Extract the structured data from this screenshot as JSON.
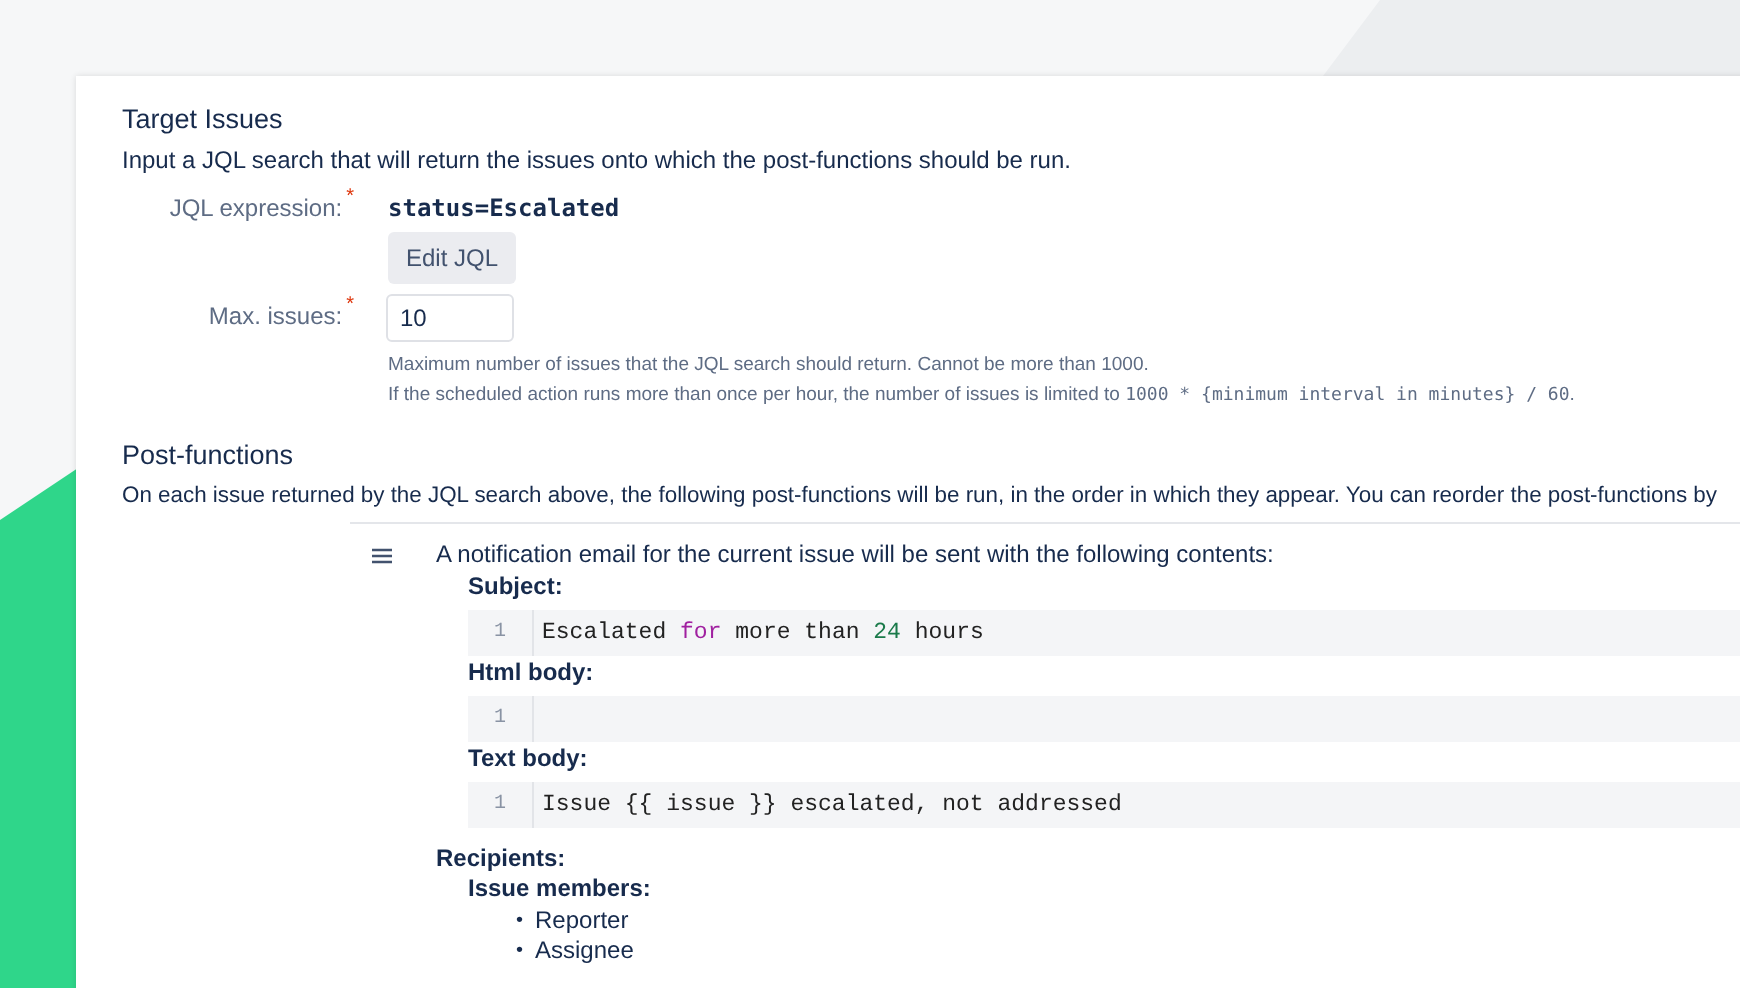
{
  "target": {
    "title": "Target Issues",
    "description": "Input a JQL search that will return the issues onto which the post-functions should be run.",
    "jql": {
      "label": "JQL expression:",
      "required_mark": "*",
      "value": "status=Escalated"
    },
    "edit_button": "Edit JQL",
    "max_issues": {
      "label": "Max. issues:",
      "required_mark": "*",
      "value": "10"
    },
    "hints": [
      [
        {
          "kind": "text",
          "text": "Maximum number of issues that the JQL search should return. Cannot be more than 1000."
        }
      ],
      [
        {
          "kind": "text",
          "text": "If the scheduled action runs more than once per hour, the number of issues is limited to "
        },
        {
          "kind": "code",
          "text": "1000 * {minimum interval in minutes} / 60"
        },
        {
          "kind": "text",
          "text": "."
        }
      ]
    ]
  },
  "post_functions": {
    "title": "Post-functions",
    "description": "On each issue returned by the JQL search above, the following post-functions will be run, in the order in which they appear. You can reorder the post-functions by",
    "items": [
      {
        "summary": "A notification email for the current issue will be sent with the following contents:",
        "fields": [
          {
            "label": "Subject:",
            "line_number": "1",
            "tokens": [
              {
                "kind": "plain",
                "text": "Escalated "
              },
              {
                "kind": "keyword",
                "text": "for"
              },
              {
                "kind": "plain",
                "text": " more than "
              },
              {
                "kind": "number",
                "text": "24"
              },
              {
                "kind": "plain",
                "text": " hours"
              }
            ]
          },
          {
            "label": "Html body:",
            "line_number": "1"
          },
          {
            "label": "Text body:",
            "line_number": "1",
            "tokens": [
              {
                "kind": "plain",
                "text": "Issue {{ issue }} escalated, not addressed"
              }
            ]
          }
        ],
        "recipients_label": "Recipients:",
        "members_label": "Issue members:",
        "members": [
          {
            "bullet": "•",
            "name": "Reporter"
          },
          {
            "bullet": "•",
            "name": "Assignee"
          }
        ]
      }
    ]
  }
}
